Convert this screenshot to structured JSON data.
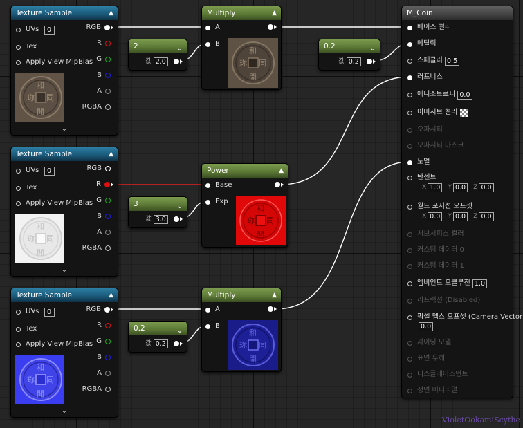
{
  "texture_nodes": [
    {
      "title": "Texture Sample",
      "uvs_label": "UVs",
      "uvs_value": "0",
      "tex_label": "Tex",
      "mip_label": "Apply View MipBias",
      "outputs": [
        "RGB",
        "R",
        "G",
        "B",
        "A",
        "RGBA"
      ],
      "preview": "coin-color"
    },
    {
      "title": "Texture Sample",
      "uvs_label": "UVs",
      "uvs_value": "0",
      "tex_label": "Tex",
      "mip_label": "Apply View MipBias",
      "outputs": [
        "RGB",
        "R",
        "G",
        "B",
        "A",
        "RGBA"
      ],
      "preview": "coin-roughness"
    },
    {
      "title": "Texture Sample",
      "uvs_label": "UVs",
      "uvs_value": "0",
      "tex_label": "Tex",
      "mip_label": "Apply View MipBias",
      "outputs": [
        "RGB",
        "R",
        "G",
        "B",
        "A",
        "RGBA"
      ],
      "preview": "coin-normal"
    }
  ],
  "constants": {
    "c1": {
      "title": "2",
      "val_label": "값",
      "value": "2.0"
    },
    "c2": {
      "title": "3",
      "val_label": "값",
      "value": "3.0"
    },
    "c3": {
      "title": "0.2",
      "val_label": "값",
      "value": "0.2"
    },
    "c4": {
      "title": "0.2",
      "val_label": "값",
      "value": "0.2"
    }
  },
  "math_nodes": {
    "multiply1": {
      "title": "Multiply",
      "in_a": "A",
      "in_b": "B"
    },
    "power": {
      "title": "Power",
      "in_a": "Base",
      "in_b": "Exp"
    },
    "multiply2": {
      "title": "Multiply",
      "in_a": "A",
      "in_b": "B"
    }
  },
  "material": {
    "title": "M_Coin",
    "inputs": {
      "base_color": "베이스 컬러",
      "metallic": "메탈릭",
      "specular": "스페큘러",
      "specular_value": "0.5",
      "roughness": "러프니스",
      "anisotropy": "애니소트로피",
      "anisotropy_value": "0.0",
      "emissive": "이미시브 컬러",
      "opacity": "오파시티",
      "opacity_mask": "오파시티 마스크",
      "normal": "노멀",
      "tangent": "탄젠트",
      "tangent_x": "1.0",
      "tangent_y": "0.0",
      "tangent_z": "0.0",
      "world_offset": "월드 포지션 오프셋",
      "wo_x": "0.0",
      "wo_y": "0.0",
      "wo_z": "0.0",
      "subsurface": "서브서피스 컬러",
      "custom0": "커스텀 데이터 0",
      "custom1": "커스텀 데이터 1",
      "ao": "앰비언트 오클루전",
      "ao_value": "1.0",
      "refraction": "리프랙션 (Disabled)",
      "pixel_depth": "픽셀 뎁스 오프셋 (Camera Vector)",
      "pixel_depth_value": "0.0",
      "shading_model": "셰이딩 모델",
      "surface_thickness": "표면 두께",
      "displacement": "디스플레이스먼트",
      "front_material": "정면 머티리얼"
    },
    "axis_x": "X",
    "axis_y": "Y",
    "axis_z": "Z"
  },
  "watermark": "VioletOokamiScythe",
  "colors": {
    "blue_header": "#1b5a7b",
    "green_header": "#5d7a36",
    "gray_header": "#454545",
    "background": "#262626"
  }
}
